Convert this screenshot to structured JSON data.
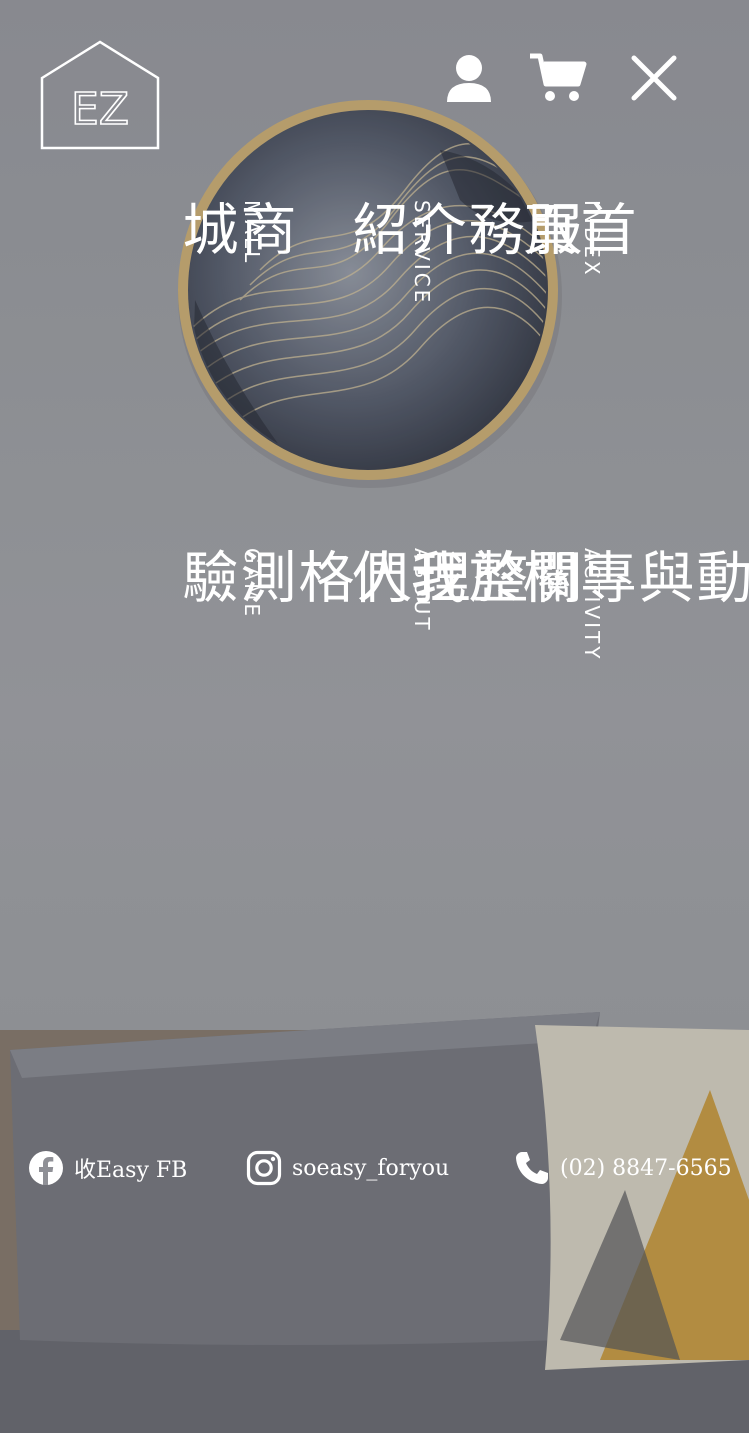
{
  "brand": {
    "logo_text": "EZ"
  },
  "header": {
    "icons": [
      "user-icon",
      "cart-icon",
      "close-icon"
    ]
  },
  "menu": [
    {
      "zh": "首頁",
      "en": "INDEX"
    },
    {
      "zh": "服務介紹",
      "en": "SERVICE"
    },
    {
      "zh": "商城",
      "en": "MALL"
    },
    {
      "zh": "活動與專欄",
      "en": "ACTIVITY"
    },
    {
      "zh": "關於我們",
      "en": "ABOUT"
    },
    {
      "zh": "整理人格測驗",
      "en": "GAME"
    }
  ],
  "footer": {
    "facebook": {
      "label": "收Easy FB",
      "icon": "facebook-icon"
    },
    "instagram": {
      "label": "soeasy_foryou",
      "icon": "instagram-icon"
    },
    "phone": {
      "label": "(02) 8847-6565",
      "icon": "phone-icon"
    }
  },
  "colors": {
    "wall": "#9a9ca2",
    "overlay_text": "#ffffff",
    "frame": "#d2b47c",
    "pillow_grey": "#7c7e86",
    "accent_gold": "#c99a3c"
  }
}
